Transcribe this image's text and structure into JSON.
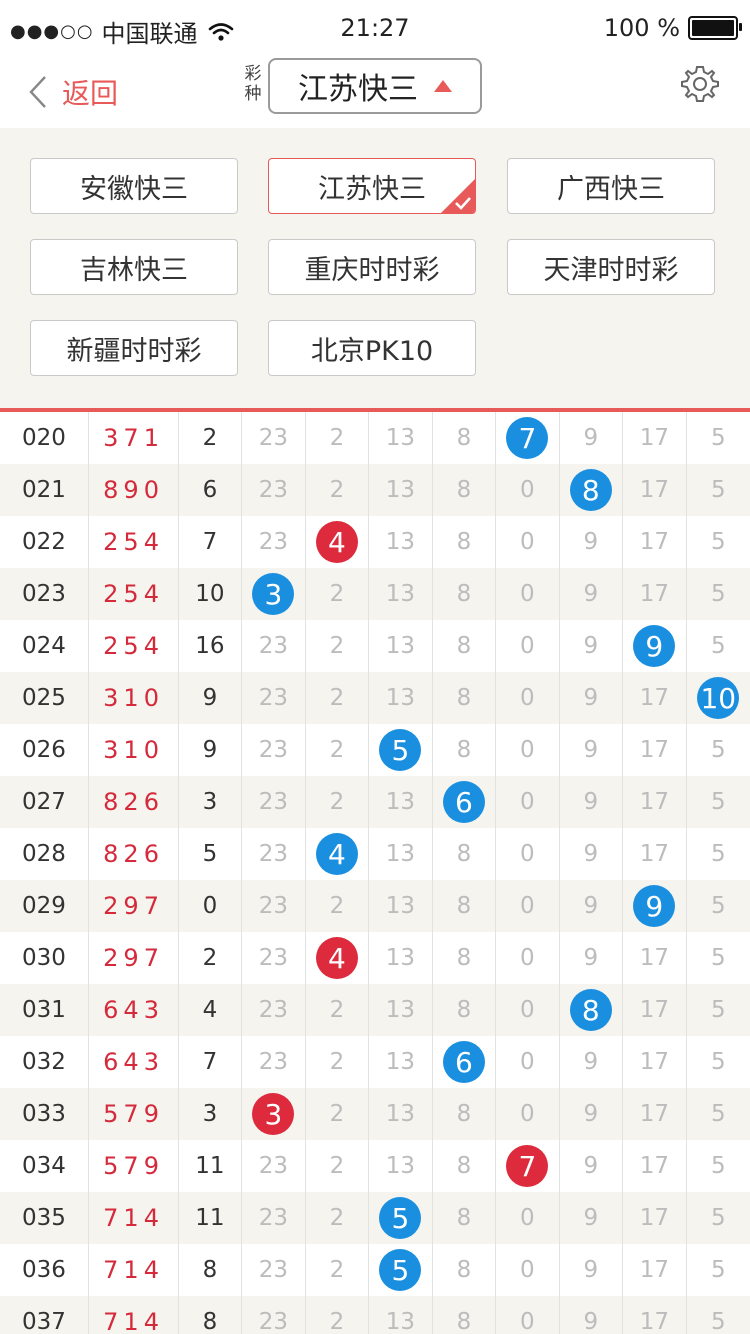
{
  "status_bar": {
    "carrier": "中国联通",
    "time": "21:27",
    "battery": "100 %"
  },
  "nav": {
    "back_label": "返回",
    "type_label": "彩种",
    "selected_lottery": "江苏快三"
  },
  "lottery_options": [
    {
      "label": "安徽快三",
      "selected": false
    },
    {
      "label": "江苏快三",
      "selected": true
    },
    {
      "label": "广西快三",
      "selected": false
    },
    {
      "label": "吉林快三",
      "selected": false
    },
    {
      "label": "重庆时时彩",
      "selected": false
    },
    {
      "label": "天津时时彩",
      "selected": false
    },
    {
      "label": "新疆时时彩",
      "selected": false
    },
    {
      "label": "北京PK10",
      "selected": false
    }
  ],
  "colors": {
    "accent": "#e85a5a",
    "ball_blue": "#1a8fe0",
    "ball_red": "#dd2a3c",
    "panel_bg": "#f5f4ee"
  },
  "table": {
    "rows": [
      {
        "issue": "020",
        "draw": "371",
        "sum": "2",
        "cells": [
          "23",
          "2",
          "13",
          "8",
          "7",
          "9",
          "17",
          "5"
        ],
        "ball": {
          "index": 4,
          "value": "7",
          "color": "blue"
        }
      },
      {
        "issue": "021",
        "draw": "890",
        "sum": "6",
        "cells": [
          "23",
          "2",
          "13",
          "8",
          "0",
          "8",
          "17",
          "5"
        ],
        "ball": {
          "index": 5,
          "value": "8",
          "color": "blue"
        }
      },
      {
        "issue": "022",
        "draw": "254",
        "sum": "7",
        "cells": [
          "23",
          "4",
          "13",
          "8",
          "0",
          "9",
          "17",
          "5"
        ],
        "ball": {
          "index": 1,
          "value": "4",
          "color": "red"
        }
      },
      {
        "issue": "023",
        "draw": "254",
        "sum": "10",
        "cells": [
          "3",
          "2",
          "13",
          "8",
          "0",
          "9",
          "17",
          "5"
        ],
        "ball": {
          "index": 0,
          "value": "3",
          "color": "blue"
        }
      },
      {
        "issue": "024",
        "draw": "254",
        "sum": "16",
        "cells": [
          "23",
          "2",
          "13",
          "8",
          "0",
          "9",
          "9",
          "5"
        ],
        "ball": {
          "index": 6,
          "value": "9",
          "color": "blue"
        }
      },
      {
        "issue": "025",
        "draw": "310",
        "sum": "9",
        "cells": [
          "23",
          "2",
          "13",
          "8",
          "0",
          "9",
          "17",
          "10"
        ],
        "ball": {
          "index": 7,
          "value": "10",
          "color": "blue"
        }
      },
      {
        "issue": "026",
        "draw": "310",
        "sum": "9",
        "cells": [
          "23",
          "2",
          "5",
          "8",
          "0",
          "9",
          "17",
          "5"
        ],
        "ball": {
          "index": 2,
          "value": "5",
          "color": "blue"
        }
      },
      {
        "issue": "027",
        "draw": "826",
        "sum": "3",
        "cells": [
          "23",
          "2",
          "13",
          "6",
          "0",
          "9",
          "17",
          "5"
        ],
        "ball": {
          "index": 3,
          "value": "6",
          "color": "blue"
        }
      },
      {
        "issue": "028",
        "draw": "826",
        "sum": "5",
        "cells": [
          "23",
          "4",
          "13",
          "8",
          "0",
          "9",
          "17",
          "5"
        ],
        "ball": {
          "index": 1,
          "value": "4",
          "color": "blue"
        }
      },
      {
        "issue": "029",
        "draw": "297",
        "sum": "0",
        "cells": [
          "23",
          "2",
          "13",
          "8",
          "0",
          "9",
          "9",
          "5"
        ],
        "ball": {
          "index": 6,
          "value": "9",
          "color": "blue"
        }
      },
      {
        "issue": "030",
        "draw": "297",
        "sum": "2",
        "cells": [
          "23",
          "4",
          "13",
          "8",
          "0",
          "9",
          "17",
          "5"
        ],
        "ball": {
          "index": 1,
          "value": "4",
          "color": "red"
        }
      },
      {
        "issue": "031",
        "draw": "643",
        "sum": "4",
        "cells": [
          "23",
          "2",
          "13",
          "8",
          "0",
          "8",
          "17",
          "5"
        ],
        "ball": {
          "index": 5,
          "value": "8",
          "color": "blue"
        }
      },
      {
        "issue": "032",
        "draw": "643",
        "sum": "7",
        "cells": [
          "23",
          "2",
          "13",
          "6",
          "0",
          "9",
          "17",
          "5"
        ],
        "ball": {
          "index": 3,
          "value": "6",
          "color": "blue"
        }
      },
      {
        "issue": "033",
        "draw": "579",
        "sum": "3",
        "cells": [
          "3",
          "2",
          "13",
          "8",
          "0",
          "9",
          "17",
          "5"
        ],
        "ball": {
          "index": 0,
          "value": "3",
          "color": "red"
        }
      },
      {
        "issue": "034",
        "draw": "579",
        "sum": "11",
        "cells": [
          "23",
          "2",
          "13",
          "8",
          "7",
          "9",
          "17",
          "5"
        ],
        "ball": {
          "index": 4,
          "value": "7",
          "color": "red"
        }
      },
      {
        "issue": "035",
        "draw": "714",
        "sum": "11",
        "cells": [
          "23",
          "2",
          "5",
          "8",
          "0",
          "9",
          "17",
          "5"
        ],
        "ball": {
          "index": 2,
          "value": "5",
          "color": "blue"
        }
      },
      {
        "issue": "036",
        "draw": "714",
        "sum": "8",
        "cells": [
          "23",
          "2",
          "5",
          "8",
          "0",
          "9",
          "17",
          "5"
        ],
        "ball": {
          "index": 2,
          "value": "5",
          "color": "blue"
        }
      },
      {
        "issue": "037",
        "draw": "714",
        "sum": "8",
        "cells": [
          "23",
          "2",
          "13",
          "8",
          "0",
          "9",
          "17",
          "5"
        ],
        "ball": null
      }
    ]
  }
}
